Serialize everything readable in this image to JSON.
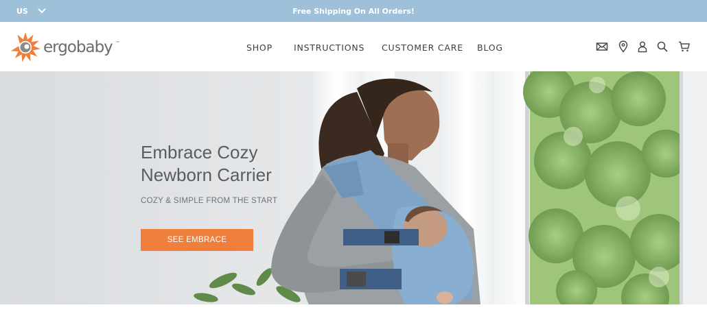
{
  "topbar": {
    "locale": "US",
    "promo": "Free Shipping On All Orders!"
  },
  "header": {
    "logo_text": "ergobaby",
    "logo_tm": "™",
    "nav": [
      {
        "label": "SHOP"
      },
      {
        "label": "INSTRUCTIONS"
      },
      {
        "label": "CUSTOMER CARE"
      },
      {
        "label": "BLOG"
      }
    ],
    "icons": [
      "mail-icon",
      "location-pin-icon",
      "account-icon",
      "search-icon",
      "cart-icon"
    ]
  },
  "hero": {
    "title_line1": "Embrace Cozy",
    "title_line2": "Newborn Carrier",
    "subtitle": "COZY & SIMPLE FROM THE START",
    "cta": "SEE EMBRACE"
  },
  "colors": {
    "topbar": "#9ec0d9",
    "cta": "#f07f3c",
    "logo_orange": "#f07f3c",
    "nav_text": "#3d3d3d"
  }
}
